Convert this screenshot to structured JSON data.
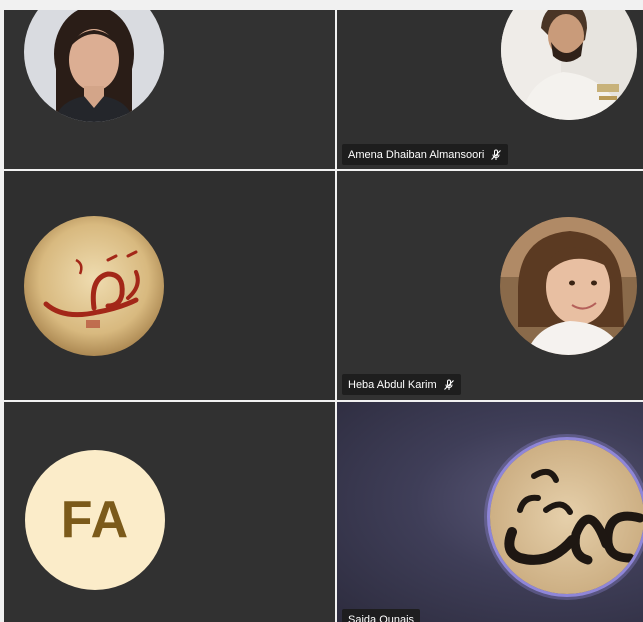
{
  "participants": [
    {
      "tile": "participant-tile-1",
      "name": "",
      "avatar_type": "photo",
      "muted": false
    },
    {
      "tile": "participant-tile-2",
      "name": "Amena Dhaiban Almansoori",
      "avatar_type": "photo",
      "muted": true
    },
    {
      "tile": "participant-tile-3",
      "name": "",
      "avatar_type": "calligraphy",
      "muted": false
    },
    {
      "tile": "participant-tile-4",
      "name": "Heba Abdul Karim",
      "avatar_type": "photo",
      "muted": true
    },
    {
      "tile": "participant-tile-5",
      "name": "",
      "avatar_type": "initials",
      "initials": "FA",
      "muted": false
    },
    {
      "tile": "participant-tile-6",
      "name": "Saida Ounais",
      "avatar_type": "calligraphy",
      "speaking": true,
      "muted": false
    }
  ],
  "icons": {
    "mic_muted": "mic-off-icon"
  },
  "colors": {
    "tile_background": "#2e2e2e",
    "nameplate_background": "#1c1c1c",
    "initials_avatar_background": "#fbecc9",
    "initials_text": "#7b5a1a",
    "speaking_ring": "#8f86d8"
  }
}
